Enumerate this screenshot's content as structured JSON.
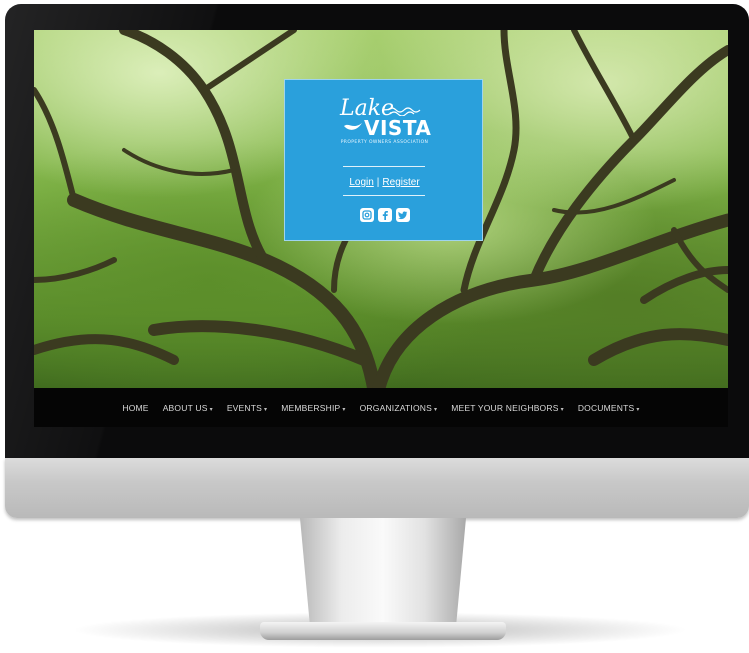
{
  "logo": {
    "name_top": "Lake",
    "name_main": "VISTA",
    "tagline": "PROPERTY OWNERS ASSOCIATION"
  },
  "auth": {
    "login_label": "Login",
    "separator": "|",
    "register_label": "Register"
  },
  "social": [
    {
      "icon": "instagram-icon"
    },
    {
      "icon": "facebook-icon"
    },
    {
      "icon": "twitter-icon"
    }
  ],
  "nav": {
    "items": [
      {
        "label": "HOME",
        "dropdown": false
      },
      {
        "label": "ABOUT US",
        "dropdown": true
      },
      {
        "label": "EVENTS",
        "dropdown": true
      },
      {
        "label": "MEMBERSHIP",
        "dropdown": true
      },
      {
        "label": "ORGANIZATIONS",
        "dropdown": true
      },
      {
        "label": "MEET YOUR NEIGHBORS",
        "dropdown": true
      },
      {
        "label": "DOCUMENTS",
        "dropdown": true
      }
    ]
  },
  "colors": {
    "brand_blue": "#2aa0dc",
    "nav_background": "#050505",
    "nav_text": "#d9d9d9"
  }
}
